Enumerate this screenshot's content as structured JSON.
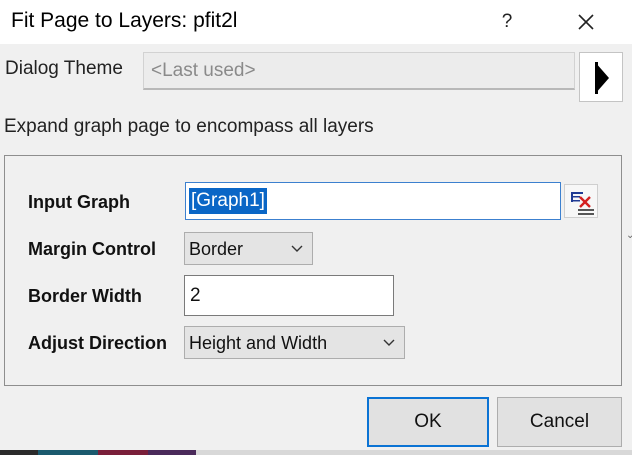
{
  "window": {
    "title": "Fit Page to Layers: pfit2l",
    "help_label": "?"
  },
  "dialog_theme": {
    "label": "Dialog Theme",
    "value": "<Last used>"
  },
  "description": "Expand graph page to encompass all layers",
  "fields": {
    "input_graph": {
      "label": "Input Graph",
      "value": "[Graph1]"
    },
    "margin_control": {
      "label": "Margin Control",
      "selected": "Border"
    },
    "border_width": {
      "label": "Border Width",
      "value": "2"
    },
    "adjust_direction": {
      "label": "Adjust Direction",
      "selected": "Height and Width"
    }
  },
  "buttons": {
    "ok": "OK",
    "cancel": "Cancel"
  },
  "colors": {
    "selection": "#0a66c6",
    "focus_border": "#0b73d4",
    "dialog_bg": "#f0f0f0"
  }
}
